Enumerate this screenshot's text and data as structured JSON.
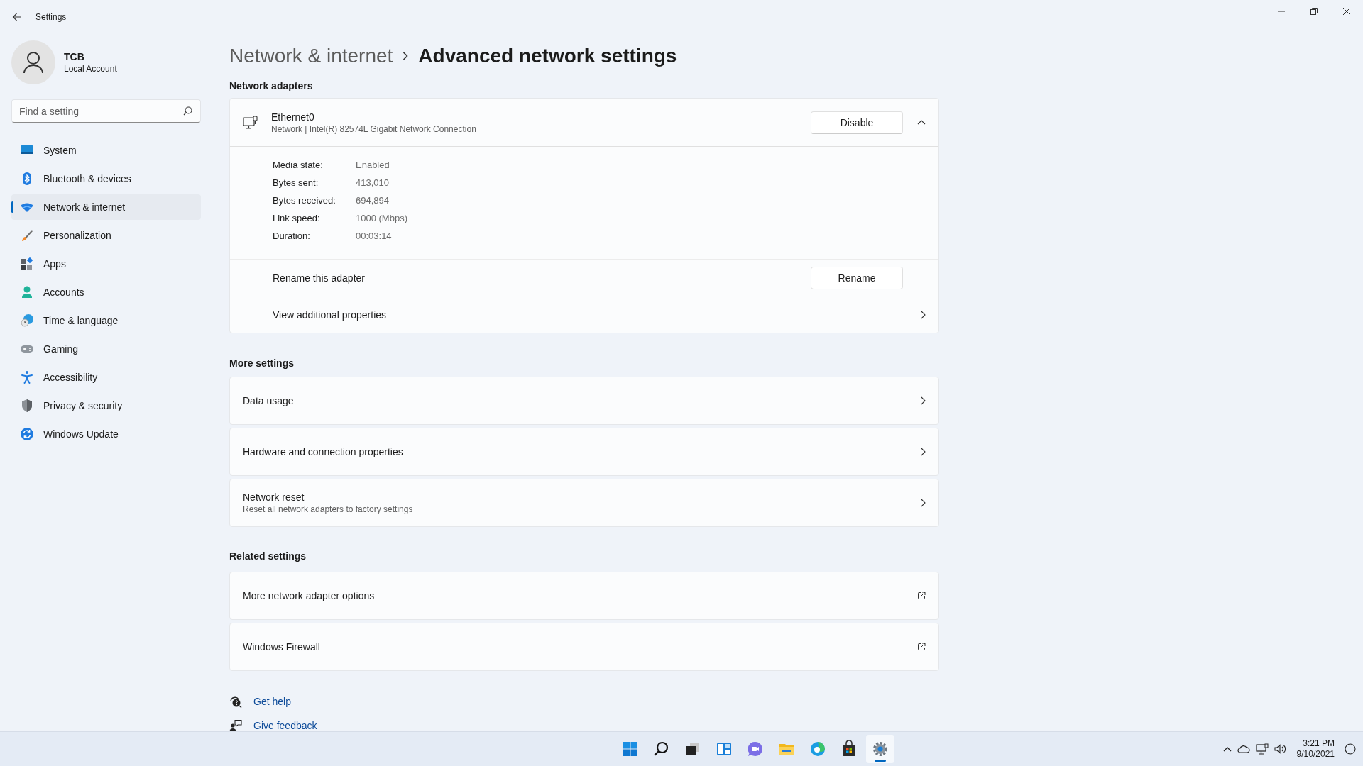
{
  "window": {
    "title": "Settings"
  },
  "profile": {
    "name": "TCB",
    "account_type": "Local Account"
  },
  "search": {
    "placeholder": "Find a setting"
  },
  "nav": [
    {
      "label": "System",
      "kind": "system",
      "selected": false
    },
    {
      "label": "Bluetooth & devices",
      "kind": "bluetooth",
      "selected": false
    },
    {
      "label": "Network & internet",
      "kind": "network",
      "selected": true
    },
    {
      "label": "Personalization",
      "kind": "personalization",
      "selected": false
    },
    {
      "label": "Apps",
      "kind": "apps",
      "selected": false
    },
    {
      "label": "Accounts",
      "kind": "accounts",
      "selected": false
    },
    {
      "label": "Time & language",
      "kind": "time",
      "selected": false
    },
    {
      "label": "Gaming",
      "kind": "gaming",
      "selected": false
    },
    {
      "label": "Accessibility",
      "kind": "accessibility",
      "selected": false
    },
    {
      "label": "Privacy & security",
      "kind": "privacy",
      "selected": false
    },
    {
      "label": "Windows Update",
      "kind": "update",
      "selected": false
    }
  ],
  "breadcrumb": {
    "parent": "Network & internet",
    "current": "Advanced network settings"
  },
  "network_adapters": {
    "heading": "Network adapters",
    "adapter": {
      "name": "Ethernet0",
      "description": "Network | Intel(R) 82574L Gigabit Network Connection",
      "button": "Disable",
      "expanded": true,
      "properties": [
        {
          "label": "Media state:",
          "value": "Enabled"
        },
        {
          "label": "Bytes sent:",
          "value": "413,010"
        },
        {
          "label": "Bytes received:",
          "value": "694,894"
        },
        {
          "label": "Link speed:",
          "value": "1000 (Mbps)"
        },
        {
          "label": "Duration:",
          "value": "00:03:14"
        }
      ],
      "rename": {
        "label": "Rename this adapter",
        "button": "Rename"
      },
      "additional": "View additional properties"
    }
  },
  "more_settings": {
    "heading": "More settings",
    "items": [
      {
        "title": "Data usage",
        "kind": "nav"
      },
      {
        "title": "Hardware and connection properties",
        "kind": "nav"
      },
      {
        "title": "Network reset",
        "subtitle": "Reset all network adapters to factory settings",
        "kind": "nav"
      }
    ]
  },
  "related_settings": {
    "heading": "Related settings",
    "items": [
      {
        "title": "More network adapter options",
        "kind": "external"
      },
      {
        "title": "Windows Firewall",
        "kind": "external"
      }
    ]
  },
  "help_links": [
    {
      "label": "Get help",
      "kind": "help"
    },
    {
      "label": "Give feedback",
      "kind": "feedback"
    }
  ],
  "taskbar": {
    "apps": [
      {
        "kind": "start",
        "selected": false
      },
      {
        "kind": "search",
        "selected": false
      },
      {
        "kind": "task-view",
        "selected": false
      },
      {
        "kind": "widgets",
        "selected": false
      },
      {
        "kind": "chat",
        "selected": false
      },
      {
        "kind": "explorer",
        "selected": false
      },
      {
        "kind": "browser",
        "selected": false
      },
      {
        "kind": "store",
        "selected": false
      },
      {
        "kind": "settings",
        "selected": true
      }
    ],
    "clock": {
      "time": "3:21 PM",
      "date": "9/10/2021"
    }
  }
}
